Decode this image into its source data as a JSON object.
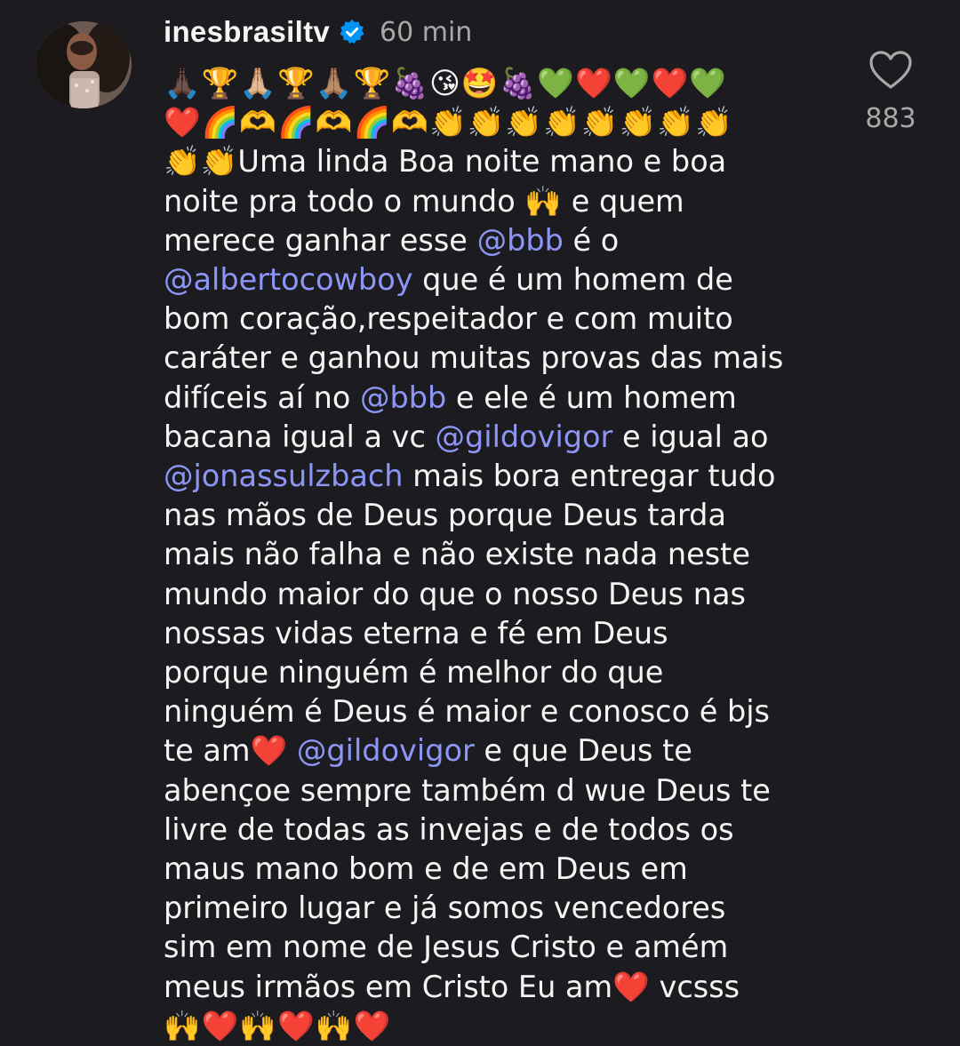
{
  "comment": {
    "username": "inesbrasiltv",
    "timestamp": "60 min",
    "like_count": "883",
    "lines": [
      [
        {
          "t": "🙏🏿🏆🙏🏼🏆🙏🏽🏆🍇😘🤩🍇💚❤️💚❤️💚"
        }
      ],
      [
        {
          "t": "❤️🌈🫶🌈🫶🌈🫶👏👏👏👏👏👏👏👏"
        }
      ],
      [
        {
          "t": "👏👏Uma linda Boa noite mano e boa"
        }
      ],
      [
        {
          "t": "noite pra todo o mundo 🙌 e quem"
        }
      ],
      [
        {
          "t": "merece ganhar esse "
        },
        {
          "t": "@bbb",
          "m": true
        },
        {
          "t": " é o"
        }
      ],
      [
        {
          "t": "@albertocowboy",
          "m": true
        },
        {
          "t": " que é um homem de"
        }
      ],
      [
        {
          "t": "bom coração,respeitador e com muito"
        }
      ],
      [
        {
          "t": "caráter e ganhou muitas provas das mais"
        }
      ],
      [
        {
          "t": "difíceis aí no "
        },
        {
          "t": "@bbb",
          "m": true
        },
        {
          "t": " e ele é um homem"
        }
      ],
      [
        {
          "t": "bacana igual a vc "
        },
        {
          "t": "@gildovigor",
          "m": true
        },
        {
          "t": " e igual ao"
        }
      ],
      [
        {
          "t": "@jonassulzbach",
          "m": true
        },
        {
          "t": " mais bora entregar tudo"
        }
      ],
      [
        {
          "t": "nas mãos de Deus porque Deus tarda"
        }
      ],
      [
        {
          "t": "mais não falha e não existe nada neste"
        }
      ],
      [
        {
          "t": "mundo maior do que o nosso Deus nas"
        }
      ],
      [
        {
          "t": "nossas vidas eterna e fé em Deus"
        }
      ],
      [
        {
          "t": "porque ninguém é melhor do que"
        }
      ],
      [
        {
          "t": "ninguém é Deus é maior e conosco é bjs"
        }
      ],
      [
        {
          "t": "te am❤️ "
        },
        {
          "t": "@gildovigor",
          "m": true
        },
        {
          "t": " e que Deus te"
        }
      ],
      [
        {
          "t": "abençoe sempre também d wue Deus te"
        }
      ],
      [
        {
          "t": "livre de todas as invejas e de todos os"
        }
      ],
      [
        {
          "t": "maus mano bom e de em Deus em"
        }
      ],
      [
        {
          "t": "primeiro lugar e já somos vencedores"
        }
      ],
      [
        {
          "t": "sim em nome de Jesus Cristo e amém"
        }
      ],
      [
        {
          "t": "meus irmãos em Cristo Eu am❤️ vcsss"
        }
      ],
      [
        {
          "t": "🙌❤️🙌❤️🙌❤️"
        }
      ]
    ]
  },
  "colors": {
    "background": "#1c1c20",
    "text": "#f5f5f5",
    "secondary_text": "#a8a8a8",
    "mention": "#8d96f6",
    "verified_badge": "#0095f6"
  },
  "icons": {
    "verified": "verified-badge-icon",
    "like": "heart-outline-icon",
    "mention_prefix": "threads-at-icon"
  }
}
